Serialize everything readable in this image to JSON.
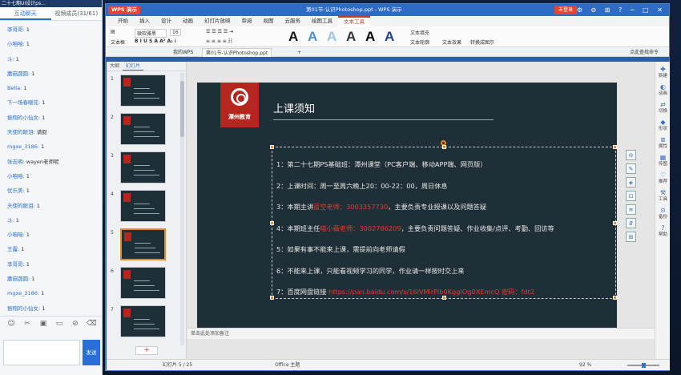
{
  "chat": {
    "window_title": "二十七期UI设计ps...",
    "tabs": [
      "互动聊天",
      "视频成员(31/61)"
    ],
    "messages": [
      {
        "name": "李哥哥:",
        "text": "1"
      },
      {
        "name": "小咱咱:",
        "text": "1"
      },
      {
        "name": "斗:",
        "text": "1"
      },
      {
        "name": "蘑菇圆圆:",
        "text": "1"
      },
      {
        "name": "Bella:",
        "text": "1"
      },
      {
        "name": "下一场春暖花:",
        "text": "1"
      },
      {
        "name": "振翔的小仙女:",
        "text": "1"
      },
      {
        "name": "天使的眼泪:",
        "text": "请假"
      },
      {
        "name": "mgxe_3186:",
        "text": "1"
      },
      {
        "name": "张志明:",
        "text": "wayen老师呢"
      },
      {
        "name": "小咱咱:",
        "text": "1"
      },
      {
        "name": "优乐美:",
        "text": "1"
      },
      {
        "name": "天使的眼泪:",
        "text": "1"
      },
      {
        "name": "斗:",
        "text": "1"
      },
      {
        "name": "小咱咱:",
        "text": "1"
      },
      {
        "name": "王露:",
        "text": "1"
      },
      {
        "name": "李哥哥:",
        "text": "1"
      },
      {
        "name": "蘑菇圆圆:",
        "text": "1"
      },
      {
        "name": "mgxe_3186:",
        "text": "1"
      },
      {
        "name": "振翔的小仙女:",
        "text": "1"
      }
    ],
    "tool_icons": [
      "☺",
      "✂",
      "▣",
      "▭",
      "⊘",
      "⌫"
    ],
    "send_label": "发送"
  },
  "app": {
    "logo": "WPS 演示",
    "doc_title": "第01节-认识Photoshop.ppt - WPS 演示",
    "login": "未登录",
    "window_controls": "⚙ ⊖ ⊞ ? ─ □ ✕",
    "menus": [
      "开始",
      "插入",
      "设计",
      "动画",
      "幻灯片放映",
      "审阅",
      "视图",
      "云服务",
      "绘图工具",
      "文本工具"
    ],
    "ribbon": {
      "font": "微软雅黑",
      "size": "16",
      "textbox": "文本框",
      "fill": "文本填充",
      "outline": "文本轮廓",
      "effect": "文本效果",
      "convert": "转换成图示"
    },
    "doc_tabs": [
      "我的WPS",
      "第01节-认识Photoshop.ppt"
    ],
    "search": "点此查找命令",
    "thumb_tabs": [
      "大纲",
      "幻灯片"
    ],
    "notes": "单击此处添加备注",
    "status": {
      "slide": "幻灯片 5 / 25",
      "theme": "Office 主题",
      "zoom": "92 %"
    }
  },
  "slide": {
    "logo_text": "潭州教育",
    "title": "上课须知",
    "lines": [
      {
        "pre": "1：第二十七期PS基础班：潭州课堂（PC客户端、移动APP端、网页版）",
        "red": "",
        "post": ""
      },
      {
        "pre": "2：上课时间：周一至周六晚上20：00-22：00，周日休息",
        "red": "",
        "post": ""
      },
      {
        "pre": "3：本期主讲",
        "red": "蓝空老师：3003357730",
        "post": "，主要负责专业授课以及问题答疑"
      },
      {
        "pre": "4：本期班主任",
        "red": "喵小薇老师：3002766209",
        "post": "，主要负责问题答疑、作业收集/点评、考勤、回访等"
      },
      {
        "pre": "5：如果有事不能来上课，需提前向老师请假",
        "red": "",
        "post": ""
      },
      {
        "pre": "6：不能来上课，只能看视频学习的同学，作业请一样按时交上来",
        "red": "",
        "post": ""
      },
      {
        "pre": "7：百度网盘链接 ",
        "red": "https://pan.baidu.com/s/16lVMirPib0KggIOg0XEmcQ 密码：fdt2",
        "post": ""
      }
    ]
  },
  "right_panel": [
    "新建",
    "动画",
    "切换",
    "形状",
    "属性",
    "传图",
    "推荐",
    "工具",
    "备份",
    "帮助"
  ],
  "side_tools": [
    "⊖",
    "✎",
    "◈",
    "⊡",
    "≋",
    "⇵",
    "⊞"
  ]
}
